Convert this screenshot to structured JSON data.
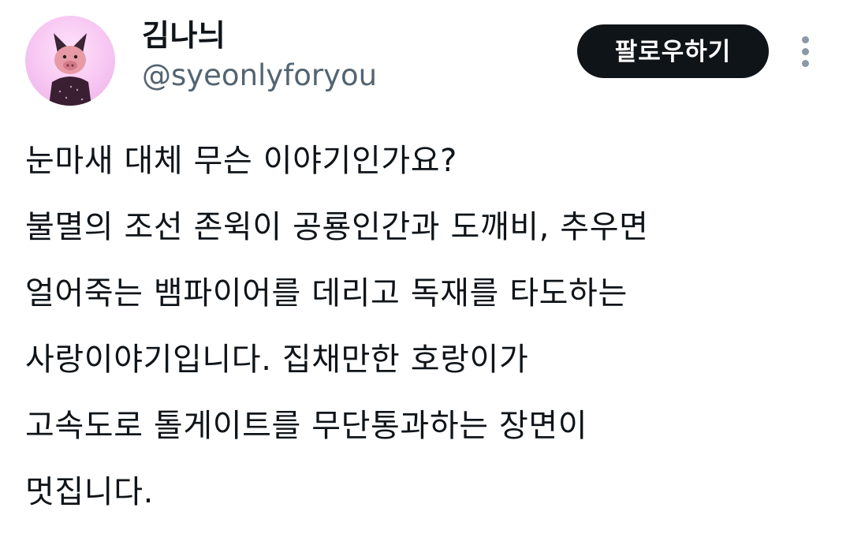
{
  "tweet": {
    "author": {
      "display_name": "김나늬",
      "handle": "@syeonlyforyou",
      "avatar_icon": "pink-pig-character-avatar"
    },
    "follow_label": "팔로우하기",
    "more_icon": "more-options-vertical-icon",
    "lines": [
      "눈마새 대체 무슨 이야기인가요?",
      "불멸의 조선 존윅이 공룡인간과 도깨비, 추우면",
      "얼어죽는 뱀파이어를 데리고 독재를 타도하는",
      "사랑이야기입니다. 집채만한 호랑이가",
      "고속도로 톨게이트를 무단통과하는 장면이",
      "멋집니다."
    ]
  },
  "colors": {
    "text_primary": "#0f1419",
    "text_secondary": "#536471",
    "button_bg": "#0f1419",
    "button_text": "#ffffff",
    "avatar_bg": "#f7c6f2"
  }
}
